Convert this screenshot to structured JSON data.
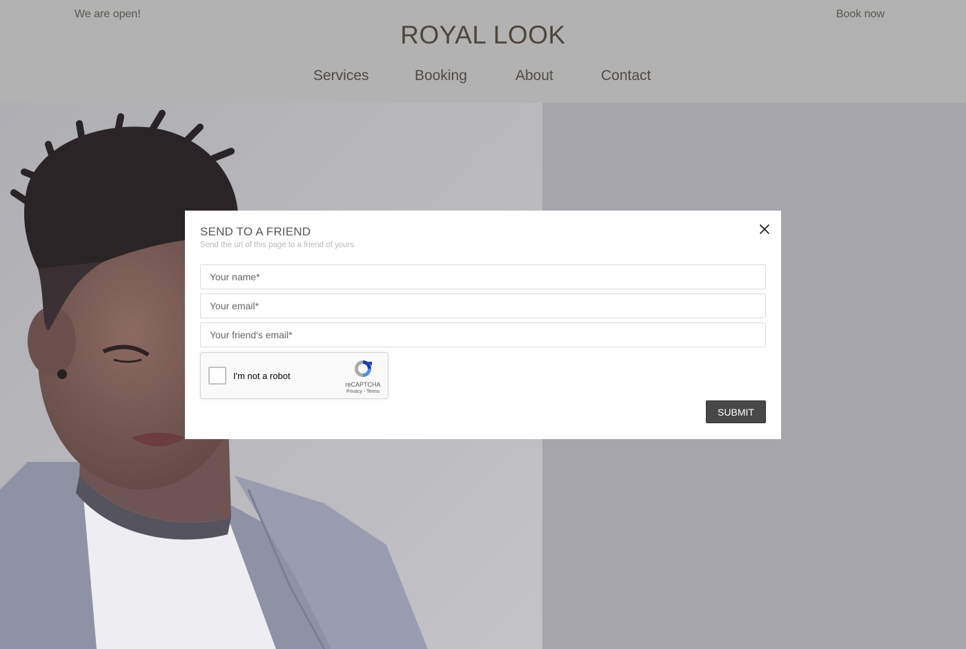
{
  "header": {
    "open_note": "We are open!",
    "brand": "ROYAL LOOK",
    "book_now": "Book now",
    "nav": [
      "Services",
      "Booking",
      "About",
      "Contact"
    ]
  },
  "modal": {
    "title": "SEND TO A FRIEND",
    "subtitle": "Send the url of this page to a friend of yours",
    "fields": {
      "name_placeholder": "Your name*",
      "email_placeholder": "Your email*",
      "friend_email_placeholder": "Your friend's email*"
    },
    "captcha": {
      "label": "I'm not a robot",
      "brand": "reCAPTCHA",
      "links": "Privacy - Terms"
    },
    "submit_label": "SUBMIT"
  },
  "icons": {
    "close": "close-icon",
    "captcha_logo": "recaptcha-icon"
  },
  "colors": {
    "header_bg": "#b2b2b2",
    "brand_text": "#4d463c",
    "submit_bg": "#484848",
    "captcha_blue": "#1c3aa9"
  }
}
